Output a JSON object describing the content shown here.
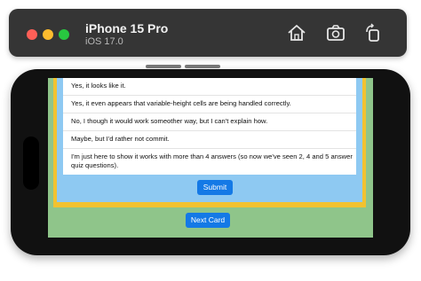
{
  "simulator": {
    "device_name": "iPhone 15 Pro",
    "os_version": "iOS 17.0",
    "icons": [
      "home-icon",
      "screenshot-icon",
      "rotate-icon"
    ]
  },
  "quiz": {
    "answers": [
      "Yes, it looks like it.",
      "Yes, it even appears that variable-height cells are being handled correctly.",
      "No, I though it would work someother way, but I can't explain how.",
      "Maybe, but I'd rather not commit.",
      "I'm just here to show it works with more than 4 answers (so now we've seen 2, 4 and 5 answer quiz questions)."
    ],
    "submit_label": "Submit",
    "next_label": "Next Card"
  },
  "colors": {
    "background_green": "#8fc58a",
    "frame_yellow": "#f2c230",
    "inner_blue": "#8ec9f2",
    "button_blue": "#1479e6"
  }
}
